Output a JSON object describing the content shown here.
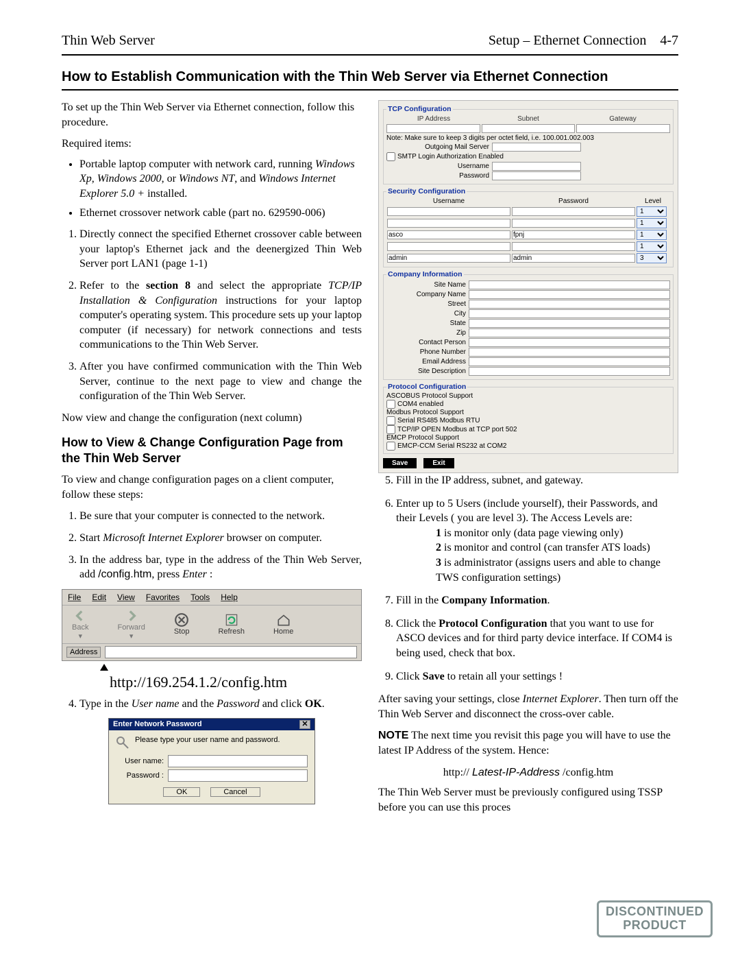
{
  "header": {
    "left": "Thin Web Server",
    "right": "Setup – Ethernet Connection",
    "pageNo": "4-7"
  },
  "title": "How to Establish Communication with the Thin Web Server via Ethernet Connection",
  "left": {
    "intro": "To set up the Thin Web Server via Ethernet connection, follow this procedure.",
    "required": "Required items:",
    "req1a": "Portable laptop computer with network card, running ",
    "req1b": "Windows Xp",
    "req1c": ", ",
    "req1d": "Windows 2000",
    "req1e": ", or ",
    "req1f": "Windows NT",
    "req1g": ", and ",
    "req1h": "Windows Internet Explorer 5.0 +",
    "req1i": " installed.",
    "req2": "Ethernet crossover network cable (part no. 629590-006)",
    "s1": "Directly connect the specified Ethernet crossover cable between your laptop's Ethernet jack and the deenergized Thin Web Server port LAN1 (page 1-1)",
    "s2a": "Refer to the ",
    "s2b": "section 8",
    "s2c": " and select the appropriate ",
    "s2d": "TCP/IP Installation & Configuration",
    "s2e": " instructions for your laptop computer's operating system. This procedure sets up your laptop computer (if necessary) for network connections and tests communications to the Thin Web Server.",
    "s3": "After you have confirmed communication with the Thin Web Server, continue to the next page to view and change the configuration of the Thin Web Server.",
    "nowView": "Now view and change the configuration  (next column)",
    "subTitle": "How to View & Change Configuration Page from the Thin Web Server",
    "sub1": "To view and change configuration pages on a client computer, follow these steps:",
    "o1": "Be sure that your computer is connected to the network.",
    "o2a": "Start ",
    "o2b": "Microsoft Internet Explorer",
    "o2c": " browser on computer.",
    "o3a": "In the address bar, type in the address of the Thin Web Server, add ",
    "o3b": "/config.htm",
    "o3c": ", press ",
    "o3d": "Enter",
    "o3e": " :",
    "url": "http://169.254.1.2/config.htm",
    "o4a": "Type in the ",
    "o4b": "User name",
    "o4c": " and the ",
    "o4d": "Password",
    "o4e": " and click ",
    "o4f": "OK",
    "o4g": "."
  },
  "ie": {
    "menu": [
      "File",
      "Edit",
      "View",
      "Favorites",
      "Tools",
      "Help"
    ],
    "back": "Back",
    "forward": "Forward",
    "stop": "Stop",
    "refresh": "Refresh",
    "home": "Home",
    "address": "Address"
  },
  "login": {
    "title": "Enter Network Password",
    "hint": "Please type your user name and password.",
    "user": "User name:",
    "pass": "Password :",
    "ok": "OK",
    "cancel": "Cancel",
    "close": "✕"
  },
  "cfg": {
    "tcpLegend": "TCP Configuration",
    "ip": "IP Address",
    "subnet": "Subnet",
    "gateway": "Gateway",
    "note": "Note: Make sure to keep 3 digits per octet field, i.e. 100.001.002.003",
    "outMail": "Outgoing Mail Server",
    "smtp": "SMTP Login Authorization Enabled",
    "uname": "Username",
    "pword": "Password",
    "secLegend": "Security Configuration",
    "secHdr": [
      "Username",
      "Password",
      "Level"
    ],
    "secRows": [
      {
        "u": "",
        "p": "",
        "l": "1"
      },
      {
        "u": "",
        "p": "",
        "l": "1"
      },
      {
        "u": "asco",
        "p": "fpnj",
        "l": "1"
      },
      {
        "u": "",
        "p": "",
        "l": "1"
      },
      {
        "u": "admin",
        "p": "admin",
        "l": "3"
      }
    ],
    "coLegend": "Company Information",
    "coFields": [
      "Site Name",
      "Company Name",
      "Street",
      "City",
      "State",
      "Zip",
      "Contact Person",
      "Phone Number",
      "Email Address",
      "Site Description"
    ],
    "protLegend": "Protocol Configuration",
    "asco": "ASCOBUS Protocol Support",
    "com4": "COM4 enabled",
    "modbus": "Modbus Protocol Support",
    "ser485": "Serial RS485 Modbus RTU",
    "tcpmod": "TCP/IP OPEN Modbus at TCP port 502",
    "emcp": "EMCP Protocol Support",
    "emcpccm": "EMCP-CCM Serial RS232 at COM2",
    "save": "Save",
    "exit": "Exit"
  },
  "right": {
    "r5": "Fill in the IP address, subnet, and gateway.",
    "r6": "Enter up to 5 Users (include yourself), their Passwords, and their Levels ( you are level 3). The Access Levels are:",
    "l1a": "1",
    "l1b": " is monitor only (data page viewing only)",
    "l2a": "2",
    "l2b": " is monitor and control (can transfer ATS loads)",
    "l3a": "3",
    "l3b": " is administrator (assigns users and able to change TWS configuration settings)",
    "r7a": "Fill in the ",
    "r7b": "Company Information",
    "r7c": ".",
    "r8a": "Click the ",
    "r8b": "Protocol Configuration",
    "r8c": " that you want to use for ASCO devices and for third party device interface. If COM4 is being used, check that box.",
    "r9a": "Click ",
    "r9b": "Save",
    "r9c": " to retain all your settings !",
    "after1a": "After saving your settings, close ",
    "after1b": "Internet Explorer",
    "after1c": ". Then turn off the Thin Web Server and disconnect the cross-over cable.",
    "noteLbl": "NOTE",
    "note2": "   The next time you revisit this page you will have to use the latest IP Address of the system. Hence:",
    "urlA": "http:// ",
    "urlB": "Latest-IP-Address",
    "urlC": " /config.htm",
    "last": "The Thin Web Server must be previously configured using TSSP before you can use this proces"
  },
  "stamp": {
    "l1": "DISCONTINUED",
    "l2": "PRODUCT"
  }
}
